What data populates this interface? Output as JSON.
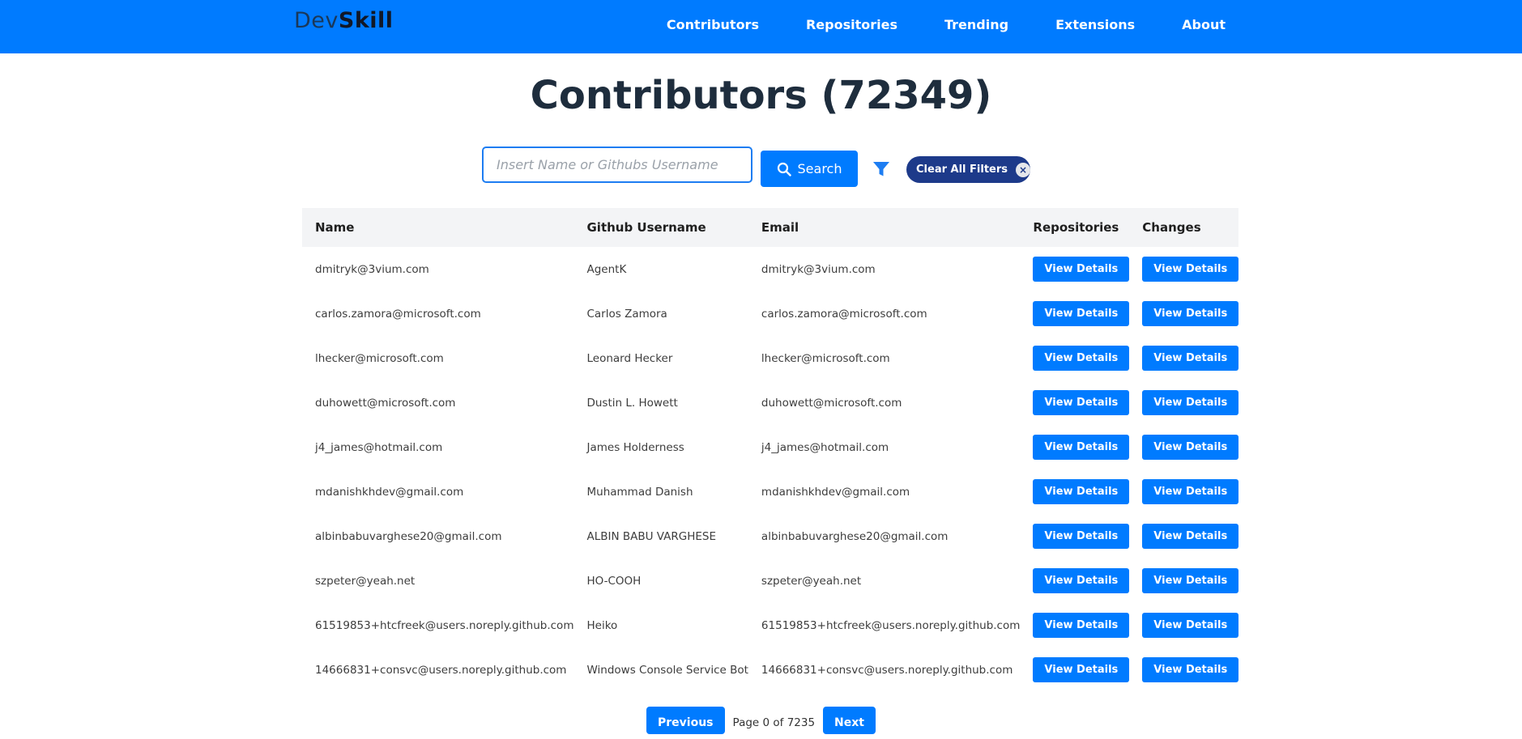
{
  "nav": {
    "logo_dev": "Dev",
    "logo_skill": "Skill",
    "links": [
      "Contributors",
      "Repositories",
      "Trending",
      "Extensions",
      "About"
    ]
  },
  "page": {
    "title": "Contributors (72349)"
  },
  "search": {
    "placeholder": "Insert Name or Githubs Username",
    "value": "",
    "button_label": "Search",
    "clear_label": "Clear All Filters",
    "clear_icon": "×"
  },
  "table": {
    "headers": [
      "Name",
      "Github Username",
      "Email",
      "Repositories",
      "Changes"
    ],
    "button_label": "View Details",
    "rows": [
      {
        "name": "dmitryk@3vium.com",
        "username": "AgentK",
        "email": "dmitryk@3vium.com"
      },
      {
        "name": "carlos.zamora@microsoft.com",
        "username": "Carlos Zamora",
        "email": "carlos.zamora@microsoft.com"
      },
      {
        "name": "lhecker@microsoft.com",
        "username": "Leonard Hecker",
        "email": "lhecker@microsoft.com"
      },
      {
        "name": "duhowett@microsoft.com",
        "username": "Dustin L. Howett",
        "email": "duhowett@microsoft.com"
      },
      {
        "name": "j4_james@hotmail.com",
        "username": "James Holderness",
        "email": "j4_james@hotmail.com"
      },
      {
        "name": "mdanishkhdev@gmail.com",
        "username": "Muhammad Danish",
        "email": "mdanishkhdev@gmail.com"
      },
      {
        "name": "albinbabuvarghese20@gmail.com",
        "username": "ALBIN BABU VARGHESE",
        "email": "albinbabuvarghese20@gmail.com"
      },
      {
        "name": "szpeter@yeah.net",
        "username": "HO-COOH",
        "email": "szpeter@yeah.net"
      },
      {
        "name": "61519853+htcfreek@users.noreply.github.com",
        "username": "Heiko",
        "email": "61519853+htcfreek@users.noreply.github.com"
      },
      {
        "name": "14666831+consvc@users.noreply.github.com",
        "username": "Windows Console Service Bot",
        "email": "14666831+consvc@users.noreply.github.com"
      }
    ]
  },
  "pagination": {
    "previous_label": "Previous",
    "page_text": "Page 0 of 7235",
    "next_label": "Next"
  },
  "icons": {
    "search": "search-icon",
    "filter": "filter-icon",
    "clear": "close-icon"
  },
  "colors": {
    "primary": "#007bff",
    "dark_badge": "#1d3a8a",
    "title": "#1e2d3d"
  }
}
